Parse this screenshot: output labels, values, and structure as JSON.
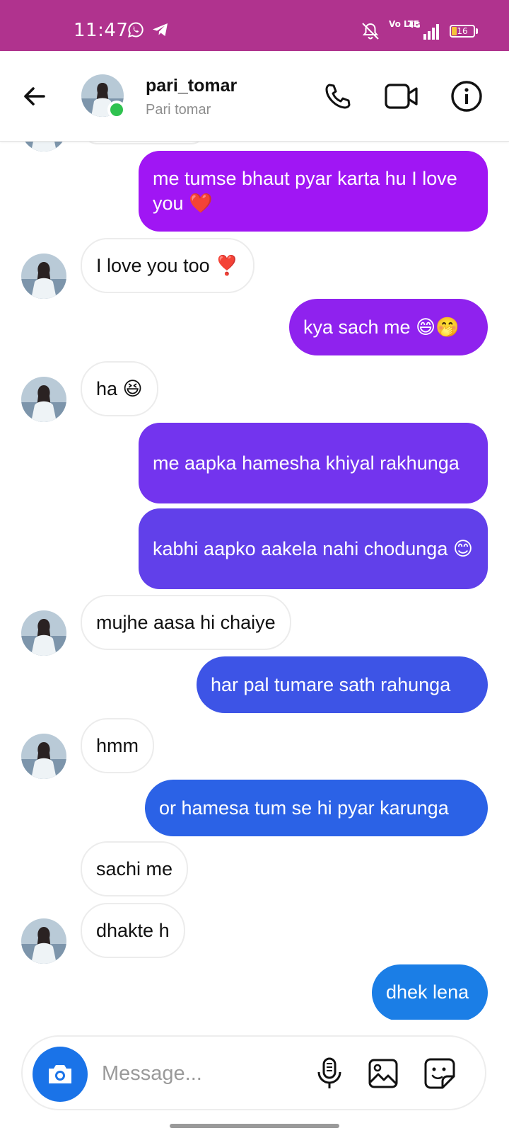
{
  "status_bar": {
    "time": "11:47",
    "network": "4G",
    "volte": "Vo LTE",
    "battery": "16",
    "colors": {
      "background": "#b0338e",
      "battery_fill": "#f4c43a"
    }
  },
  "header": {
    "username": "pari_tomar",
    "display_name": "Pari tomar",
    "icons": [
      "back-arrow-icon",
      "phone-icon",
      "video-camera-icon",
      "info-icon"
    ],
    "online_color": "#2fc24f"
  },
  "messages": [
    {
      "sender": "me",
      "text": "me tumse bhaut pyar karta hu I love you ❤️",
      "color": "#a016f4"
    },
    {
      "sender": "them",
      "text": "I love you too ❣️"
    },
    {
      "sender": "me",
      "text": "kya sach me 😄🤭",
      "color": "#8f22ee"
    },
    {
      "sender": "them",
      "text": "ha 😆"
    },
    {
      "sender": "me",
      "text": "me aapka hamesha khiyal rakhunga",
      "color": "#7334ee"
    },
    {
      "sender": "me",
      "text": "kabhi aapko aakela nahi chodunga 😊",
      "color": "#6140ea"
    },
    {
      "sender": "them",
      "text": "mujhe aasa hi chaiye"
    },
    {
      "sender": "me",
      "text": "har pal tumare sath rahunga",
      "color": "#3d54e6"
    },
    {
      "sender": "them",
      "text": "hmm"
    },
    {
      "sender": "me",
      "text": "or hamesa tum se hi pyar karunga",
      "color": "#2b62e6"
    },
    {
      "sender": "them",
      "text": "sachi me"
    },
    {
      "sender": "them",
      "text": "dhakte h"
    },
    {
      "sender": "me",
      "text": "dhek lena",
      "color": "#1b7ee6"
    }
  ],
  "composer": {
    "placeholder": "Message...",
    "icons": [
      "camera-icon",
      "microphone-icon",
      "gallery-icon",
      "sticker-icon"
    ],
    "camera_color": "#1a73e8"
  }
}
